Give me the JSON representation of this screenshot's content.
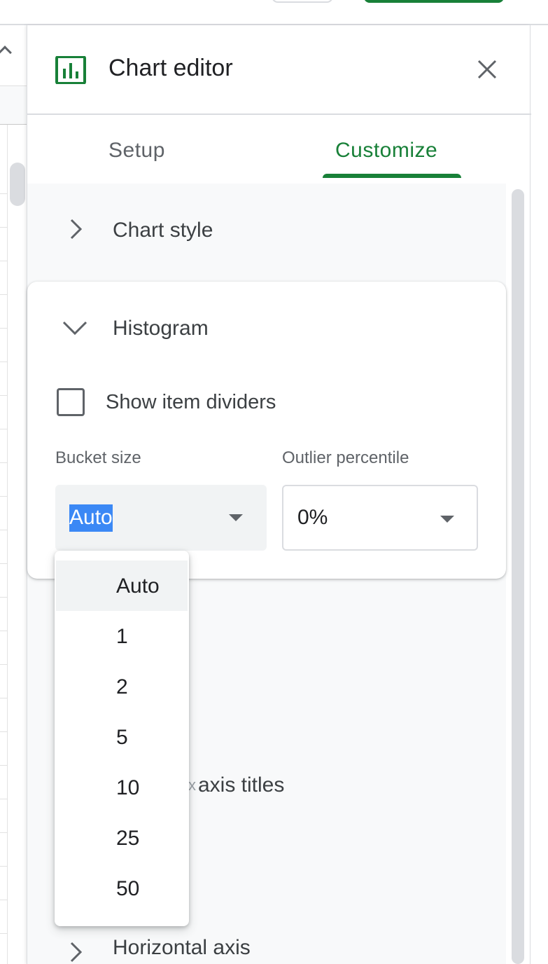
{
  "panel": {
    "title": "Chart editor"
  },
  "tabs": [
    {
      "label": "Setup",
      "active": false
    },
    {
      "label": "Customize",
      "active": true
    }
  ],
  "sections": {
    "chart_style": "Chart style",
    "histogram": "Histogram",
    "axis_titles_partial": "axis titles",
    "axis_titles_fragment": "x",
    "horizontal_axis_partial": "Horizontal axis"
  },
  "histogram": {
    "show_item_dividers_label": "Show item dividers",
    "show_item_dividers_checked": false,
    "bucket_size_label": "Bucket size",
    "bucket_size_value": "Auto",
    "outlier_label": "Outlier percentile",
    "outlier_value": "0%"
  },
  "dropdown": {
    "options": [
      "Auto",
      "1",
      "2",
      "5",
      "10",
      "25",
      "50"
    ],
    "selected": "Auto"
  },
  "colors": {
    "accent_green": "#188038",
    "selection_blue": "#3b88f5",
    "panel_bg": "#f8f9fa"
  },
  "icons": {
    "chart": "bar-chart-icon",
    "close": "close-icon",
    "collapsed": "chevron-right-icon",
    "expanded": "chevron-down-icon",
    "dropdown": "caret-down-icon"
  }
}
